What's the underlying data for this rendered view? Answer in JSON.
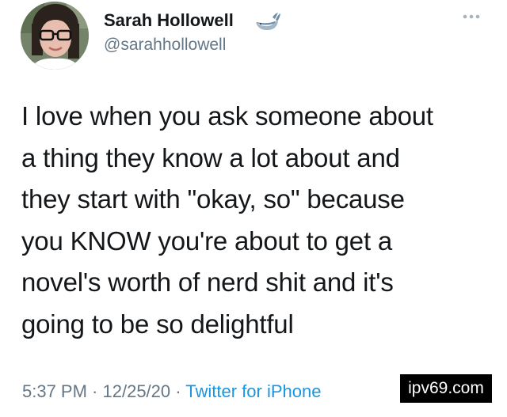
{
  "author": {
    "display_name": "Sarah Hollowell",
    "handle": "@sarahhollowell",
    "avatar_icon": "avatar-photo",
    "badge_icon": "whale-icon"
  },
  "tweet": {
    "text_lines": [
      "I love when you ask someone about",
      "a thing they know a lot about and",
      "they start with \"okay, so\" because",
      "you KNOW you're about to get a",
      "novel's worth of nerd shit and it's",
      "going to be so delightful"
    ]
  },
  "meta": {
    "time": "5:37 PM",
    "separator": " · ",
    "date": "12/25/20",
    "source": "Twitter for iPhone"
  },
  "overflow_icon": "more-icon",
  "watermark": {
    "text": "ipv69.com"
  },
  "colors": {
    "text": "#14171a",
    "secondary": "#657786",
    "link": "#1b95e0",
    "watermark_bg": "#000000"
  }
}
